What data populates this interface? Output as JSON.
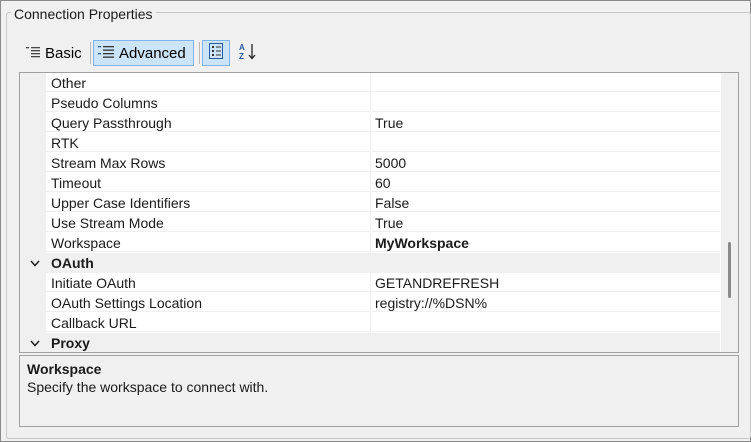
{
  "group_title": "Connection Properties",
  "toolbar": {
    "basic_label": "Basic",
    "advanced_label": "Advanced",
    "categorized_icon": "categorized-icon",
    "alphabetical_icon": "sort-az-icon"
  },
  "rows": [
    {
      "name": "Other",
      "value": ""
    },
    {
      "name": "Pseudo Columns",
      "value": ""
    },
    {
      "name": "Query Passthrough",
      "value": "True"
    },
    {
      "name": "RTK",
      "value": ""
    },
    {
      "name": "Stream Max Rows",
      "value": "5000"
    },
    {
      "name": "Timeout",
      "value": "60"
    },
    {
      "name": "Upper Case Identifiers",
      "value": "False"
    },
    {
      "name": "Use Stream Mode",
      "value": "True"
    },
    {
      "name": "Workspace",
      "value": "MyWorkspace",
      "selected": true
    }
  ],
  "categories": {
    "oauth": {
      "label": "OAuth",
      "icon": "chevron-down-icon"
    },
    "proxy": {
      "label": "Proxy",
      "icon": "chevron-down-icon"
    }
  },
  "oauth_rows": [
    {
      "name": "Initiate OAuth",
      "value": "GETANDREFRESH"
    },
    {
      "name": "OAuth Settings Location",
      "value": "registry://%DSN%"
    },
    {
      "name": "Callback URL",
      "value": ""
    }
  ],
  "description": {
    "title": "Workspace",
    "text": "Specify the workspace to connect with."
  },
  "colors": {
    "accent": "#cce4f7",
    "accent_border": "#7eb4ea",
    "category_bg": "#f0f0f0"
  }
}
